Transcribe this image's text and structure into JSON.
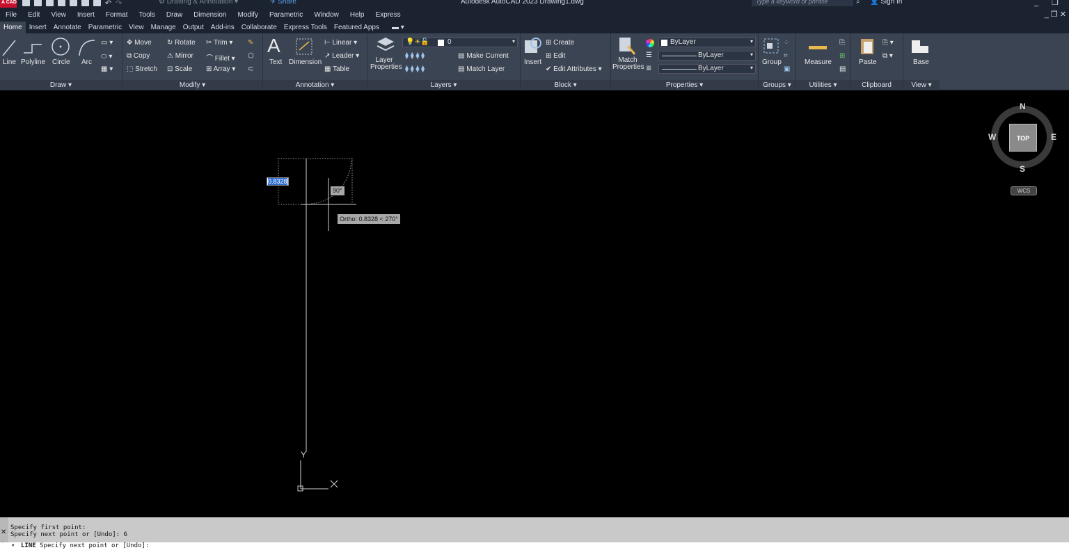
{
  "titlebar": {
    "logo": "A CAD",
    "workspace": "Drafting & Annotation",
    "share": "Share",
    "title": "Autodesk AutoCAD 2023   Drawing1.dwg",
    "search_placeholder": "Type a keyword or phrase",
    "sign_in": "Sign In"
  },
  "menu": [
    "File",
    "Edit",
    "View",
    "Insert",
    "Format",
    "Tools",
    "Draw",
    "Dimension",
    "Modify",
    "Parametric",
    "Window",
    "Help",
    "Express"
  ],
  "tabs": [
    "Home",
    "Insert",
    "Annotate",
    "Parametric",
    "View",
    "Manage",
    "Output",
    "Add-ins",
    "Collaborate",
    "Express Tools",
    "Featured Apps"
  ],
  "ribbon": {
    "draw": {
      "title": "Draw ▾",
      "line": "Line",
      "polyline": "Polyline",
      "circle": "Circle",
      "arc": "Arc"
    },
    "modify": {
      "title": "Modify ▾",
      "move": "Move",
      "rotate": "Rotate",
      "trim": "Trim",
      "copy": "Copy",
      "mirror": "Mirror",
      "fillet": "Fillet",
      "stretch": "Stretch",
      "scale": "Scale",
      "array": "Array"
    },
    "annotation": {
      "title": "Annotation ▾",
      "text": "Text",
      "dimension": "Dimension",
      "linear": "Linear",
      "leader": "Leader",
      "table": "Table"
    },
    "layers": {
      "title": "Layers ▾",
      "layer_properties": "Layer Properties",
      "current_layer": "0",
      "make_current": "Make Current",
      "match_layer": "Match Layer"
    },
    "block": {
      "title": "Block ▾",
      "insert": "Insert",
      "create": "Create",
      "edit": "Edit",
      "edit_attributes": "Edit Attributes"
    },
    "properties": {
      "title": "Properties ▾",
      "match_properties": "Match Properties",
      "color": "ByLayer",
      "linetype": "ByLayer",
      "lineweight": "ByLayer"
    },
    "groups": {
      "title": "Groups ▾",
      "group": "Group"
    },
    "utilities": {
      "title": "Utilities ▾",
      "measure": "Measure"
    },
    "clipboard": {
      "title": "Clipboard",
      "paste": "Paste"
    },
    "view": {
      "title": "View ▾",
      "base": "Base"
    }
  },
  "viewcube": {
    "n": "N",
    "s": "S",
    "e": "E",
    "w": "W",
    "face": "TOP",
    "ucs": "WCS"
  },
  "drawing": {
    "dynamic_input_value": "0.8328",
    "angle_tooltip": "90°",
    "ortho_tooltip": "Ortho: 0.8328 < 270°",
    "ucs_y": "Y"
  },
  "command": {
    "history": [
      "Specify first point:",
      "Specify next point or [Undo]: 6"
    ],
    "prompt_prefix": "LINE",
    "prompt": "Specify next point or [Undo]:"
  }
}
